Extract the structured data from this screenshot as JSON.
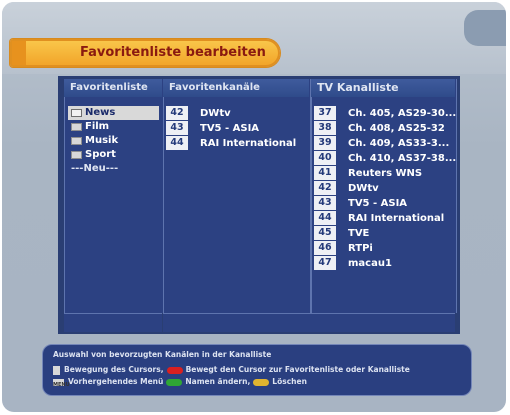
{
  "title": "Favoritenliste bearbeiten",
  "columns": {
    "favoritenliste": "Favoritenliste",
    "favoritenkanaele": "Favoritenkanäle",
    "tv_kanalliste": "TV Kanalliste"
  },
  "favorites": [
    {
      "label": "News",
      "selected": true
    },
    {
      "label": "Film",
      "selected": false
    },
    {
      "label": "Musik",
      "selected": false
    },
    {
      "label": "Sport",
      "selected": false
    }
  ],
  "favorites_new": "---Neu---",
  "favorite_channels": [
    {
      "num": "42",
      "name": "DWtv"
    },
    {
      "num": "43",
      "name": "TV5 - ASIA"
    },
    {
      "num": "44",
      "name": "RAI International"
    }
  ],
  "tv_channels": [
    {
      "num": "37",
      "name": "Ch. 405, AS29-30..."
    },
    {
      "num": "38",
      "name": "Ch. 408, AS25-32"
    },
    {
      "num": "39",
      "name": "Ch. 409, AS33-3..."
    },
    {
      "num": "40",
      "name": "Ch. 410, AS37-38..."
    },
    {
      "num": "41",
      "name": "Reuters WNS"
    },
    {
      "num": "42",
      "name": "DWtv"
    },
    {
      "num": "43",
      "name": "TV5 - ASIA"
    },
    {
      "num": "44",
      "name": "RAI International"
    },
    {
      "num": "45",
      "name": "TVE"
    },
    {
      "num": "46",
      "name": "RTPi"
    },
    {
      "num": "47",
      "name": "macau1"
    }
  ],
  "help": {
    "title": "Auswahl von bevorzugten Kanälen in der Kanalliste",
    "cursor_move": "Bewegung des Cursors,",
    "red_action": "Bewegt den Cursor zur Favoritenliste oder Kanalliste",
    "menu_icon_label": "MENU",
    "previous_menu": "Vorhergehendes Menü",
    "green_action": "Namen ändern,",
    "yellow_action": "Löschen"
  },
  "colors": {
    "title_bar": "#f2a52a",
    "title_text": "#8a1a10",
    "panel": "#2c4182",
    "red_button": "#d92020",
    "green_button": "#2fa635",
    "yellow_button": "#e0b430"
  }
}
